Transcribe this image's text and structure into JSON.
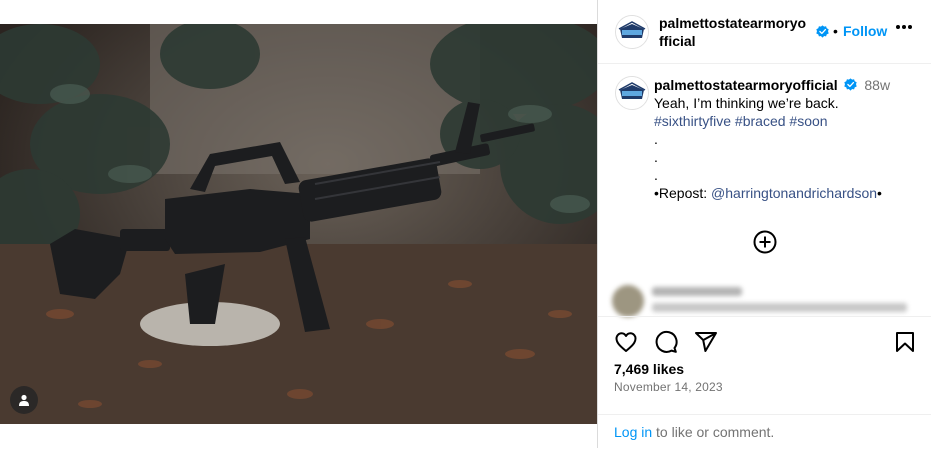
{
  "post": {
    "username": "palmettostatearmoryofficial",
    "header_username_line1": "palmettostatearmoryo",
    "header_username_line2": "fficial",
    "follow_label": "Follow",
    "separator": "•",
    "more_icon": "more-horizontal-icon",
    "verified_color": "#0095f6"
  },
  "caption": {
    "time_ago": "88w",
    "line1": "Yeah, I’m thinking we’re back.",
    "hashtags": [
      "#sixthirtyfive",
      "#braced",
      "#soon"
    ],
    "dots": [
      ".",
      ".",
      "."
    ],
    "repost_prefix": "•Repost: ",
    "repost_handle": "@harringtonandrichardson",
    "repost_suffix": "•"
  },
  "stats": {
    "likes": "7,469 likes",
    "date": "November 14, 2023"
  },
  "login": {
    "link": "Log in",
    "rest": " to like or comment."
  },
  "icons": [
    "heart-icon",
    "comment-icon",
    "share-icon",
    "bookmark-icon",
    "add-comment-icon",
    "user-tag-icon"
  ]
}
